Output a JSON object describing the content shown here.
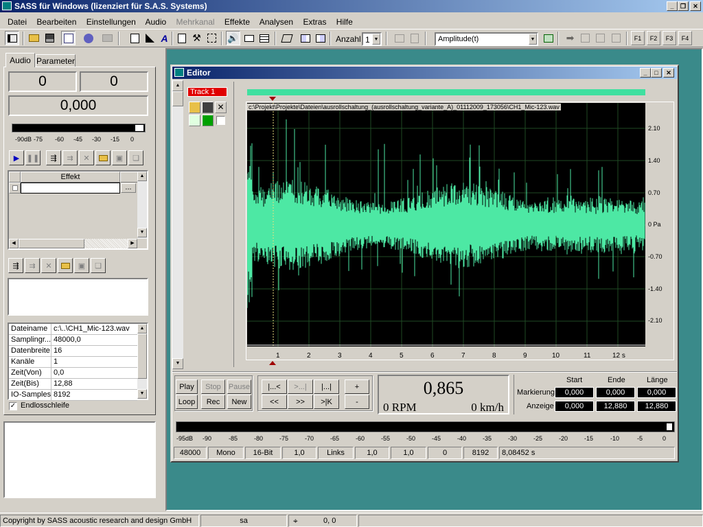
{
  "app": {
    "title": "SASS für Windows (lizenziert für S.A.S. Systems)",
    "title_bar_color": "#0a246a"
  },
  "menu": {
    "items": [
      "Datei",
      "Bearbeiten",
      "Einstellungen",
      "Audio",
      "Mehrkanal",
      "Effekte",
      "Analysen",
      "Extras",
      "Hilfe"
    ],
    "disabled_item": "Mehrkanal"
  },
  "toolbar": {
    "anzahl_label": "Anzahl",
    "anzahl_value": "1",
    "mode_select": "Amplitude(t)",
    "f_buttons": [
      "F1",
      "F2",
      "F3",
      "F4"
    ]
  },
  "left_panel": {
    "tabs": [
      "Audio",
      "Parameter"
    ],
    "active_tab": "Audio",
    "counter_left": "0",
    "counter_right": "0",
    "time_display": "0,000",
    "level_labels": [
      "-90dB",
      "-75",
      "-60",
      "-45",
      "-30",
      "-15",
      "0"
    ],
    "effects_header": "Effekt",
    "effects_ellipsis": "...",
    "properties": [
      {
        "name": "Dateiname",
        "value": "c:\\..\\CH1_Mic-123.wav"
      },
      {
        "name": "Samplingr...",
        "value": "48000,0"
      },
      {
        "name": "Datenbreite",
        "value": "16"
      },
      {
        "name": "Kanäle",
        "value": "1"
      },
      {
        "name": "Zeit(Von)",
        "value": "0,0"
      },
      {
        "name": "Zeit(Bis)",
        "value": "12,88"
      },
      {
        "name": "IO-Samples",
        "value": "8192"
      }
    ],
    "loop_label": "Endlosschleife",
    "loop_checked": true
  },
  "editor": {
    "title": "Editor",
    "track_label": "Track 1",
    "file_path": "c:\\Projekt\\Projekte\\Dateien\\ausrollschaltung_(ausrollschaltung_variante_A)_01112009_173056\\CH1_Mic-123.wav",
    "y_ticks": [
      "2.10",
      "1.40",
      "0.70",
      "0 Pa",
      "-0.70",
      "-1.40",
      "-2.10"
    ],
    "x_ticks": [
      "1",
      "2",
      "3",
      "4",
      "5",
      "6",
      "7",
      "8",
      "9",
      "10",
      "11",
      "12 s"
    ],
    "waveform_color": "#4de8a4",
    "buttons": {
      "play": "Play",
      "stop": "Stop",
      "pause": "Pause",
      "loop": "Loop",
      "rec": "Rec",
      "new": "New",
      "go_start": "|...<",
      "go_mid": ">...|",
      "go_end": "|...|",
      "rew": "<<",
      "ffw": ">>",
      "go_marker": ">|K",
      "zoom_in": "+",
      "zoom_out": "-"
    },
    "main_value": "0,865",
    "rpm": "0 RPM",
    "speed": "0 km/h",
    "markers": {
      "headers": [
        "Start",
        "Ende",
        "Länge"
      ],
      "markierung_label": "Markierung",
      "markierung": [
        "0,000",
        "0,000",
        "0,000"
      ],
      "anzeige_label": "Anzeige",
      "anzeige": [
        "0,000",
        "12,880",
        "12,880"
      ]
    },
    "vu_labels": [
      "-95dB",
      "-90",
      "-85",
      "-80",
      "-75",
      "-70",
      "-65",
      "-60",
      "-55",
      "-50",
      "-45",
      "-40",
      "-35",
      "-30",
      "-25",
      "-20",
      "-15",
      "-10",
      "-5",
      "0"
    ],
    "status": [
      "48000",
      "Mono",
      "16-Bit",
      "1,0",
      "Links",
      "1,0",
      "1,0",
      "0",
      "8192",
      "8,08452 s"
    ]
  },
  "statusbar": {
    "copyright": "Copyright by SASS acoustic research and design GmbH",
    "user": "sa",
    "coords": "0, 0"
  }
}
